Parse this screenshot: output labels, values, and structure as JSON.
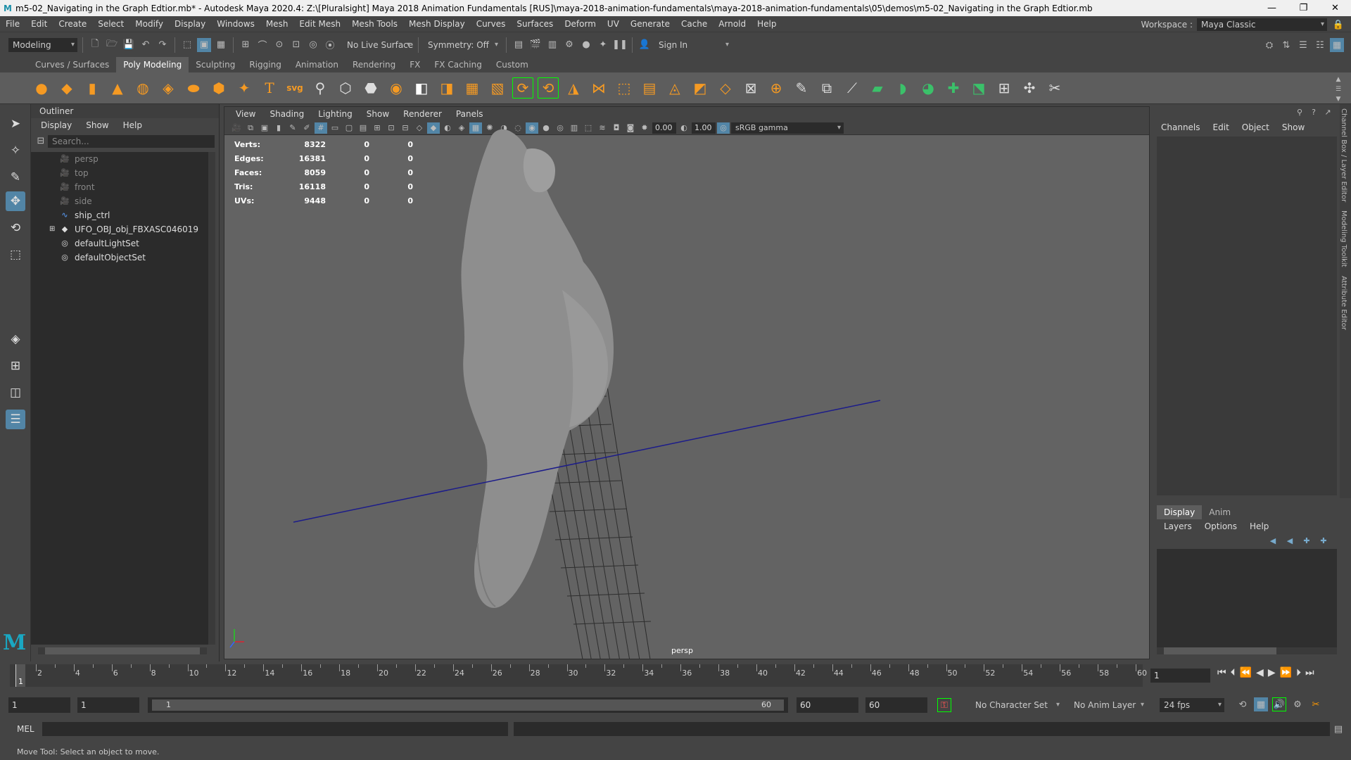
{
  "window": {
    "title": "m5-02_Navigating in the Graph Edtior.mb* - Autodesk Maya 2020.4: Z:\\[Pluralsight] Maya 2018 Animation Fundamentals [RUS]\\maya-2018-animation-fundamentals\\maya-2018-animation-fundamentals\\05\\demos\\m5-02_Navigating in the Graph Edtior.mb",
    "minimize": "—",
    "restore": "❐",
    "close": "✕"
  },
  "menu": [
    "File",
    "Edit",
    "Create",
    "Select",
    "Modify",
    "Display",
    "Windows",
    "Mesh",
    "Edit Mesh",
    "Mesh Tools",
    "Mesh Display",
    "Curves",
    "Surfaces",
    "Deform",
    "UV",
    "Generate",
    "Cache",
    "Arnold",
    "Help"
  ],
  "workspace": {
    "label": "Workspace :",
    "value": "Maya Classic"
  },
  "statusline": {
    "mode": "Modeling",
    "live_surface": "No Live Surface",
    "symmetry": "Symmetry: Off",
    "sign_in": "Sign In"
  },
  "shelf_tabs": [
    "Curves / Surfaces",
    "Poly Modeling",
    "Sculpting",
    "Rigging",
    "Animation",
    "Rendering",
    "FX",
    "FX Caching",
    "Custom"
  ],
  "shelf_active_tab": "Poly Modeling",
  "outliner": {
    "title": "Outliner",
    "menu": [
      "Display",
      "Show",
      "Help"
    ],
    "search_placeholder": "Search...",
    "items": [
      {
        "label": "persp",
        "icon": "camera-icon",
        "dim": true
      },
      {
        "label": "top",
        "icon": "camera-icon",
        "dim": true
      },
      {
        "label": "front",
        "icon": "camera-icon",
        "dim": true
      },
      {
        "label": "side",
        "icon": "camera-icon",
        "dim": true
      },
      {
        "label": "ship_ctrl",
        "icon": "curve-icon",
        "dim": false
      },
      {
        "label": "UFO_OBJ_obj_FBXASC046019",
        "icon": "group-icon",
        "dim": false
      },
      {
        "label": "defaultLightSet",
        "icon": "set-icon",
        "dim": false
      },
      {
        "label": "defaultObjectSet",
        "icon": "set-icon",
        "dim": false
      }
    ]
  },
  "viewport": {
    "menu": [
      "View",
      "Shading",
      "Lighting",
      "Show",
      "Renderer",
      "Panels"
    ],
    "exposure": "0.00",
    "gamma": "1.00",
    "color_space": "sRGB gamma",
    "camera": "persp",
    "stats": [
      {
        "label": "Verts:",
        "value": "8322",
        "a": "0",
        "b": "0"
      },
      {
        "label": "Edges:",
        "value": "16381",
        "a": "0",
        "b": "0"
      },
      {
        "label": "Faces:",
        "value": "8059",
        "a": "0",
        "b": "0"
      },
      {
        "label": "Tris:",
        "value": "16118",
        "a": "0",
        "b": "0"
      },
      {
        "label": "UVs:",
        "value": "9448",
        "a": "0",
        "b": "0"
      }
    ]
  },
  "channel_box": {
    "menu": [
      "Channels",
      "Edit",
      "Object",
      "Show"
    ],
    "layer_tabs": [
      "Display",
      "Anim"
    ],
    "layer_menu": [
      "Layers",
      "Options",
      "Help"
    ],
    "side_tabs": [
      "Channel Box / Layer Editor",
      "Modeling Toolkit",
      "Attribute Editor"
    ]
  },
  "timeline": {
    "ticks": [
      "2",
      "4",
      "6",
      "8",
      "10",
      "12",
      "14",
      "16",
      "18",
      "20",
      "22",
      "24",
      "26",
      "28",
      "30",
      "32",
      "34",
      "36",
      "38",
      "40",
      "42",
      "44",
      "46",
      "48",
      "50",
      "52",
      "54",
      "56",
      "58",
      "60"
    ],
    "current": "1",
    "current_field": "1"
  },
  "range": {
    "start": "1",
    "playback_start": "1",
    "bar_start": "1",
    "bar_end": "60",
    "playback_end": "60",
    "end": "60",
    "character_set": "No Character Set",
    "anim_layer": "No Anim Layer",
    "fps": "24 fps"
  },
  "command_line": {
    "label": "MEL"
  },
  "help_line": "Move Tool: Select an object to move.",
  "colors": {
    "accent": "#5285a6",
    "axis_line": "#1c1c8a"
  }
}
